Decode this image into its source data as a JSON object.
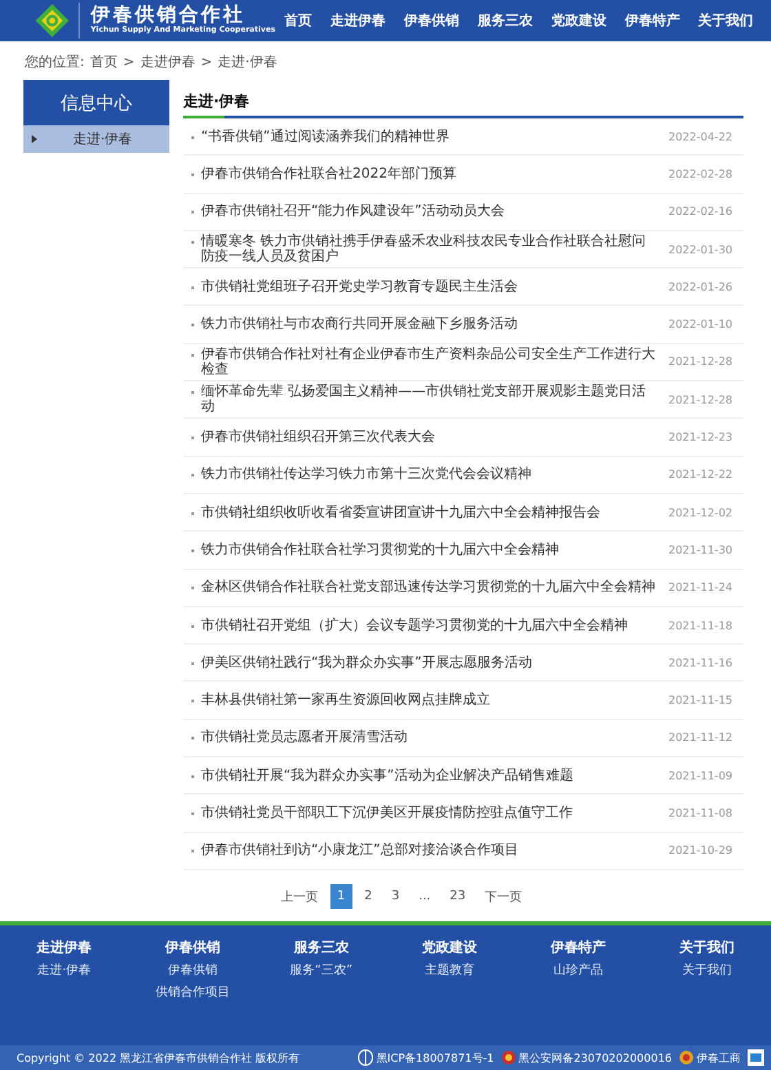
{
  "header": {
    "title": "伊春供销合作社",
    "subtitle": "Yichun Supply And Marketing Cooperatives",
    "nav": [
      {
        "label": "首页"
      },
      {
        "label": "走进伊春"
      },
      {
        "label": "伊春供销"
      },
      {
        "label": "服务三农"
      },
      {
        "label": "党政建设"
      },
      {
        "label": "伊春特产"
      },
      {
        "label": "关于我们"
      }
    ]
  },
  "breadcrumb": {
    "label": "您的位置:",
    "items": [
      "首页",
      "走进伊春",
      "走进·伊春"
    ],
    "separator": ">"
  },
  "sidebar": {
    "title": "信息中心",
    "items": [
      {
        "label": "走进·伊春",
        "selected": true
      }
    ]
  },
  "section_title": "走进·伊春",
  "articles": [
    {
      "title": "“书香供销”通过阅读涵养我们的精神世界",
      "date": "2022-04-22"
    },
    {
      "title": "伊春市供销合作社联合社2022年部门预算",
      "date": "2022-02-28"
    },
    {
      "title": "伊春市供销社召开“能力作风建设年”活动动员大会",
      "date": "2022-02-16"
    },
    {
      "title": "情暖寒冬 铁力市供销社携手伊春盛禾农业科技农民专业合作社联合社慰问防疫一线人员及贫困户",
      "date": "2022-01-30"
    },
    {
      "title": "市供销社党组班子召开党史学习教育专题民主生活会",
      "date": "2022-01-26"
    },
    {
      "title": "铁力市供销社与市农商行共同开展金融下乡服务活动",
      "date": "2022-01-10"
    },
    {
      "title": "伊春市供销合作社对社有企业伊春市生产资料杂品公司安全生产工作进行大检查",
      "date": "2021-12-28"
    },
    {
      "title": "缅怀革命先辈 弘扬爱国主义精神——市供销社党支部开展观影主题党日活动",
      "date": "2021-12-28"
    },
    {
      "title": "伊春市供销社组织召开第三次代表大会",
      "date": "2021-12-23"
    },
    {
      "title": "铁力市供销社传达学习铁力市第十三次党代会会议精神",
      "date": "2021-12-22"
    },
    {
      "title": "市供销社组织收听收看省委宣讲团宣讲十九届六中全会精神报告会",
      "date": "2021-12-02"
    },
    {
      "title": "铁力市供销合作社联合社学习贯彻党的十九届六中全会精神",
      "date": "2021-11-30"
    },
    {
      "title": "金林区供销合作社联合社党支部迅速传达学习贯彻党的十九届六中全会精神",
      "date": "2021-11-24"
    },
    {
      "title": "市供销社召开党组（扩大）会议专题学习贯彻党的十九届六中全会精神",
      "date": "2021-11-18"
    },
    {
      "title": "伊美区供销社践行“我为群众办实事”开展志愿服务活动",
      "date": "2021-11-16"
    },
    {
      "title": "丰林县供销社第一家再生资源回收网点挂牌成立",
      "date": "2021-11-15"
    },
    {
      "title": "市供销社党员志愿者开展清雪活动",
      "date": "2021-11-12"
    },
    {
      "title": "市供销社开展“我为群众办实事”活动为企业解决产品销售难题",
      "date": "2021-11-09"
    },
    {
      "title": "市供销社党员干部职工下沉伊美区开展疫情防控驻点值守工作",
      "date": "2021-11-08"
    },
    {
      "title": "伊春市供销社到访“小康龙江”总部对接洽谈合作项目",
      "date": "2021-10-29"
    }
  ],
  "pagination": [
    {
      "label": "上一页",
      "selected": false
    },
    {
      "label": "1",
      "selected": true
    },
    {
      "label": "2",
      "selected": false
    },
    {
      "label": "3",
      "selected": false
    },
    {
      "label": "...",
      "selected": false
    },
    {
      "label": "23",
      "selected": false
    },
    {
      "label": "下一页",
      "selected": false
    }
  ],
  "footer_columns": [
    {
      "heading": "走进伊春",
      "links": [
        "走进·伊春"
      ]
    },
    {
      "heading": "伊春供销",
      "links": [
        "伊春供销",
        "供销合作项目"
      ]
    },
    {
      "heading": "服务三农",
      "links": [
        "服务“三农”"
      ]
    },
    {
      "heading": "党政建设",
      "links": [
        "主题教育"
      ]
    },
    {
      "heading": "伊春特产",
      "links": [
        "山珍产品"
      ]
    },
    {
      "heading": "关于我们",
      "links": [
        "关于我们"
      ]
    }
  ],
  "copyright": "Copyright © 2022 黑龙江省伊春市供销合作社 版权所有",
  "badges": [
    {
      "kind": "icp",
      "label": "黑ICP备18007871号-1"
    },
    {
      "kind": "police",
      "label": "黑公安网备23070202000016"
    },
    {
      "kind": "emblem",
      "label": "伊春工商"
    },
    {
      "kind": "seal"
    }
  ]
}
